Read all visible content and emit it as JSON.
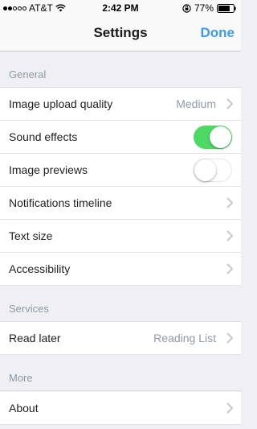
{
  "status_bar": {
    "carrier": "AT&T",
    "time": "2:42 PM",
    "battery_percent": "77%",
    "battery_level": 0.77,
    "signal_bars_filled": 2,
    "signal_bars_total": 5
  },
  "nav": {
    "title": "Settings",
    "done_label": "Done"
  },
  "sections": {
    "general": {
      "header": "General",
      "image_upload_quality": {
        "label": "Image upload quality",
        "value": "Medium"
      },
      "sound_effects": {
        "label": "Sound effects",
        "enabled": true
      },
      "image_previews": {
        "label": "Image previews",
        "enabled": false
      },
      "notifications_timeline": {
        "label": "Notifications timeline"
      },
      "text_size": {
        "label": "Text size"
      },
      "accessibility": {
        "label": "Accessibility"
      }
    },
    "services": {
      "header": "Services",
      "read_later": {
        "label": "Read later",
        "value": "Reading List"
      }
    },
    "more": {
      "header": "More",
      "about": {
        "label": "About"
      }
    }
  },
  "colors": {
    "accent": "#3d9be9",
    "toggle_on": "#4cd964",
    "secondary_text": "#8e9aa4",
    "background": "#efeff4"
  },
  "icons": {
    "wifi": "wifi-icon",
    "lock": "rotation-lock-icon",
    "battery": "battery-icon",
    "chevron": "chevron-right-icon"
  }
}
